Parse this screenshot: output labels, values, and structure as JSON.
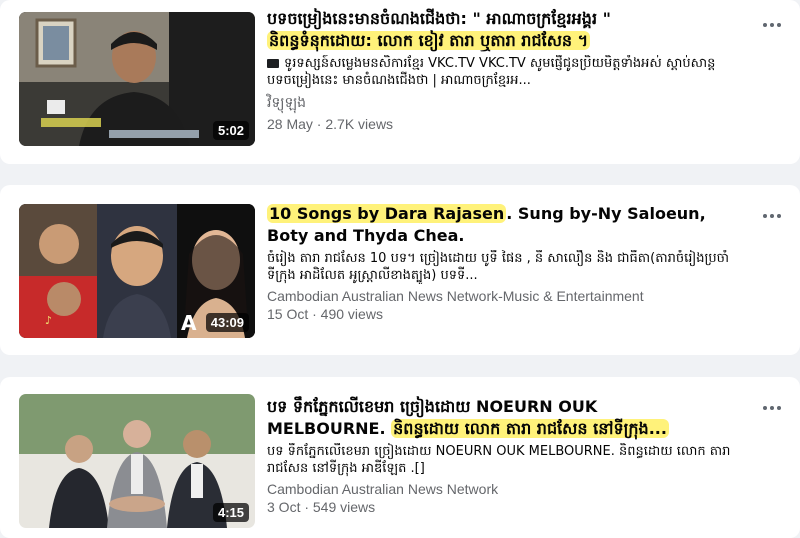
{
  "videos": [
    {
      "title_highlight": "",
      "title_line1": "បទចម្រៀងនេះមានចំណងជើងថា: \" អាណាចក្រខ្មែរអង្គរ \"",
      "title_line2": "និពន្ធទំនុកដោយ: លោក ខៀវ តារា ឬតារា រាជសែន ។",
      "description": "ទូរទស្សន៍សម្លេងមនសិការខ្មែរ VKC.TV VKC.TV សូមផ្ញើជូនប្រិយមិត្តទាំងអស់ ស្ដាប់សាន្ត បទចម្រៀងនេះ មានចំណងជើងថា | អាណាចក្រខ្មែរអ...",
      "channel": "វិទ្យុឡុង",
      "meta": "28 May · 2.7K views",
      "duration": "5:02"
    },
    {
      "title_highlight": "10 Songs by Dara Rajasen",
      "title_rest": ". Sung by-Ny Saloeun, Boty and Thyda Chea.",
      "description": "ចំរៀង តារា រាជសែន 10 បទ។ ច្រៀងដោយ បូទី ផៃន , នី សាលឿន និង ជាធីតា(តារាចំរៀងប្រចាំទីក្រុង អាដិលែត អូស្ត្រាលីខាងត្បូង) បទទី...",
      "channel": "Cambodian Australian News Network-Music & Entertainment",
      "meta": "15 Oct · 490 views",
      "duration": "43:09"
    },
    {
      "title_line1": "បទ ទឹកភ្នែកលើខេមរា ច្រៀងដោយ NOEURN OUK",
      "title_line2_a": "MELBOURNE. ",
      "title_line2_hl": "និពន្ធដោយ លោក តារា រាជសែន នៅទីក្រុង...",
      "description": "បទ ទឹកភ្នែកលើខេមរា ច្រៀងដោយ NOEURN OUK MELBOURNE. និពន្ធដោយ លោក តារា រាជសែន នៅទីក្រុង អាឌីឡែត .[]",
      "channel": "Cambodian Australian News Network",
      "meta": "3 Oct · 549 views",
      "duration": "4:15"
    }
  ],
  "colors": {
    "highlight": "#fff27a",
    "background": "#f0f2f5",
    "secondary_text": "#65676b"
  },
  "icons": [
    "more-options-icon",
    "tv-icon"
  ]
}
